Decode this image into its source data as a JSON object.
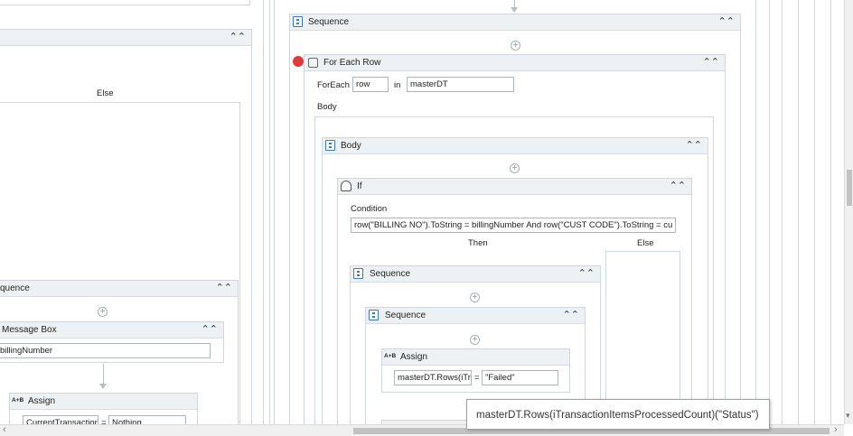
{
  "left": {
    "else_label": "Else",
    "sequence_title": "quence",
    "message_box_title": "Message Box",
    "message_box_value": "billingNumber",
    "assign_title": "Assign",
    "assign_to": "CurrentTransactior",
    "assign_eq": "=",
    "assign_value": "Nothing",
    "icon_assign_text": "A+B"
  },
  "right": {
    "sequence_title": "Sequence",
    "foreach_title": "For Each Row",
    "foreach_label": "ForEach",
    "foreach_var": "row",
    "in_label": "in",
    "foreach_source": "masterDT",
    "body_label": "Body",
    "body_seq_title": "Body",
    "if_title": "If",
    "condition_label": "Condition",
    "condition_value": "row(\"BILLING NO\").ToString = billingNumber And row(\"CUST CODE\").ToString = cu",
    "then_label": "Then",
    "else_label": "Else",
    "then_seq_title": "Sequence",
    "inner_seq_title": "Sequence",
    "assign_title": "Assign",
    "assign_to": "masterDT.Rows(iTr",
    "assign_eq": "=",
    "assign_value": "\"Failed\"",
    "icon_assign_text": "A+B"
  },
  "tooltip": {
    "text": "masterDT.Rows(iTransactionItemsProcessedCount)(\"Status\")"
  },
  "scrollbar": {
    "left_arrow": "‹",
    "right_arrow": "›",
    "down_arrow": "▾"
  },
  "colors": {
    "header_bg": "#eef1f4",
    "border": "#cfd6dc",
    "breakpoint": "#e03a3a",
    "icon_blue": "#3c78c8"
  }
}
